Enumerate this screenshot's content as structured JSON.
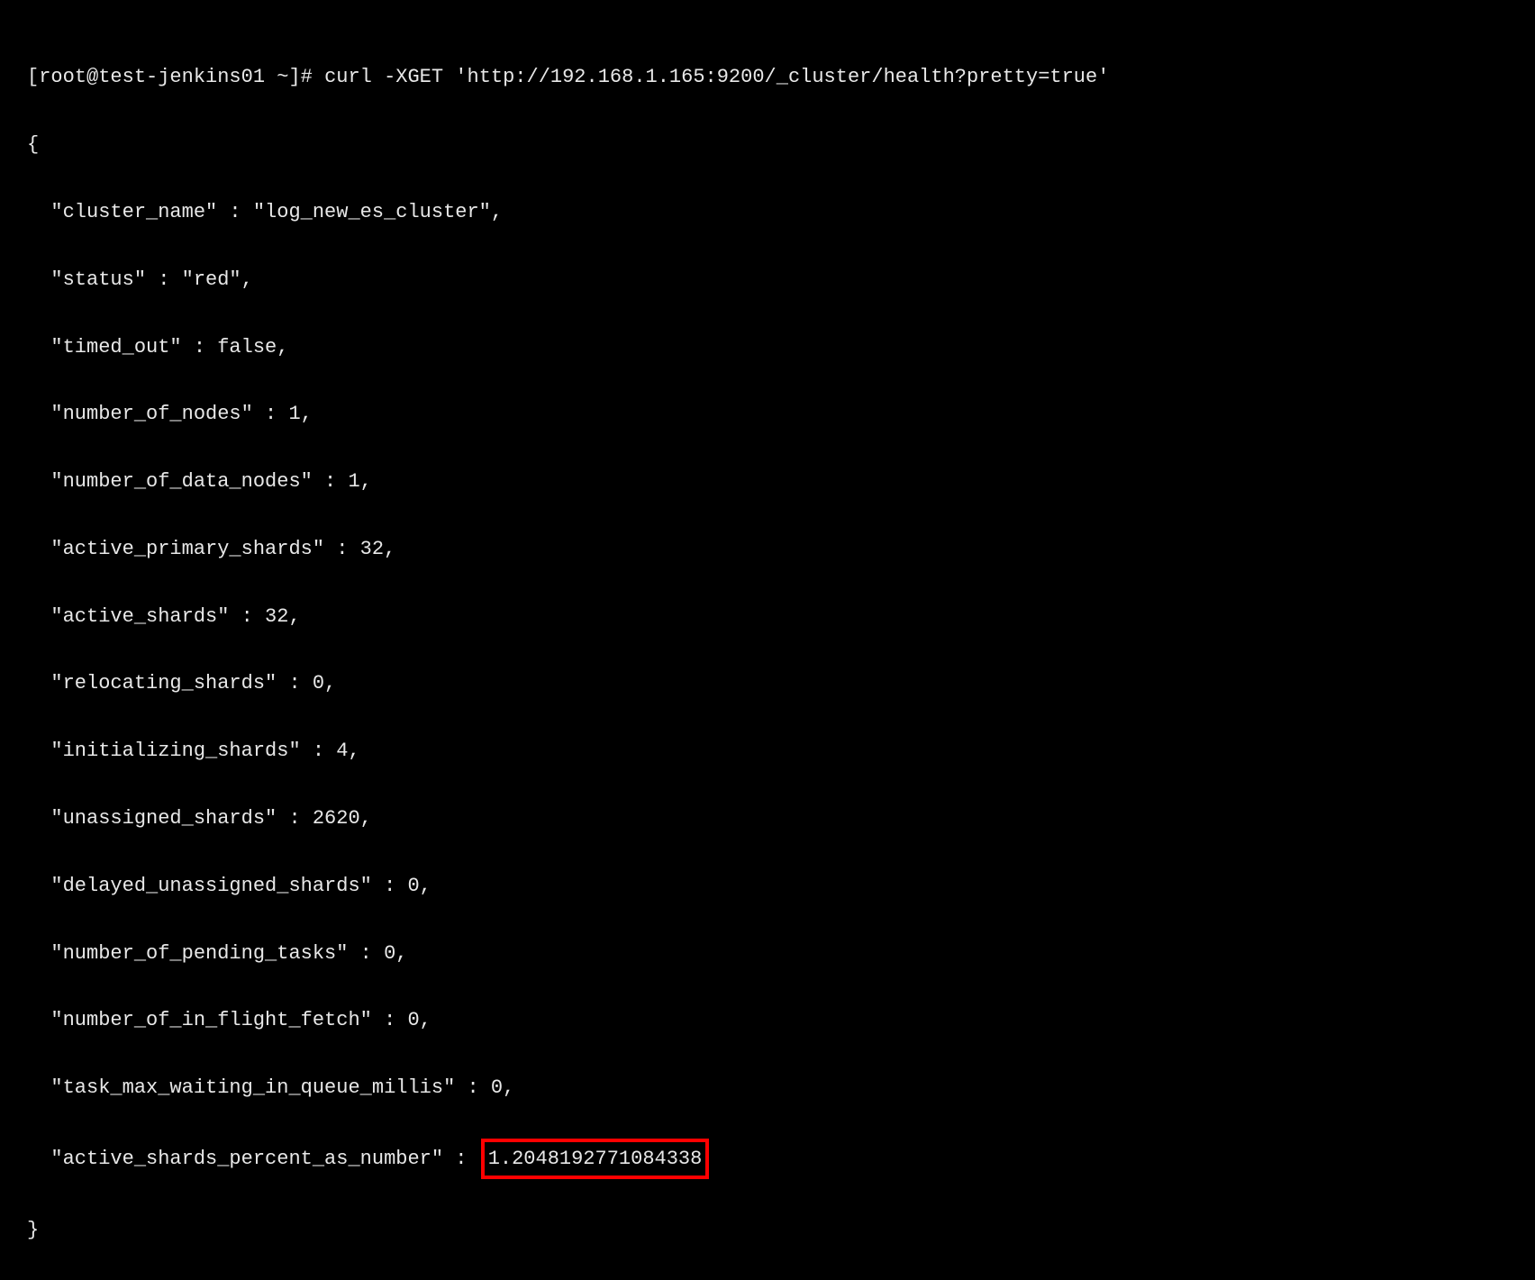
{
  "terminal": {
    "prompt": "[root@test-jenkins01 ~]# ",
    "command": "curl -XGET 'http://192.168.1.165:9200/_cluster/health?pretty=true'",
    "json_open": "{",
    "json_close": "}",
    "lines": {
      "cluster_name": "  \"cluster_name\" : \"log_new_es_cluster\",",
      "status": "  \"status\" : \"red\",",
      "timed_out": "  \"timed_out\" : false,",
      "number_of_nodes": "  \"number_of_nodes\" : 1,",
      "number_of_data_nodes": "  \"number_of_data_nodes\" : 1,",
      "active_primary_shards": "  \"active_primary_shards\" : 32,",
      "active_shards": "  \"active_shards\" : 32,",
      "relocating_shards": "  \"relocating_shards\" : 0,",
      "initializing_shards": "  \"initializing_shards\" : 4,",
      "unassigned_shards": "  \"unassigned_shards\" : 2620,",
      "delayed_unassigned_shards": "  \"delayed_unassigned_shards\" : 0,",
      "number_of_pending_tasks": "  \"number_of_pending_tasks\" : 0,",
      "number_of_in_flight_fetch": "  \"number_of_in_flight_fetch\" : 0,",
      "task_max_waiting_in_queue_millis": "  \"task_max_waiting_in_queue_millis\" : 0,",
      "active_shards_percent_prefix": "  \"active_shards_percent_as_number\" : ",
      "active_shards_percent_value": "1.2048192771084338"
    }
  }
}
